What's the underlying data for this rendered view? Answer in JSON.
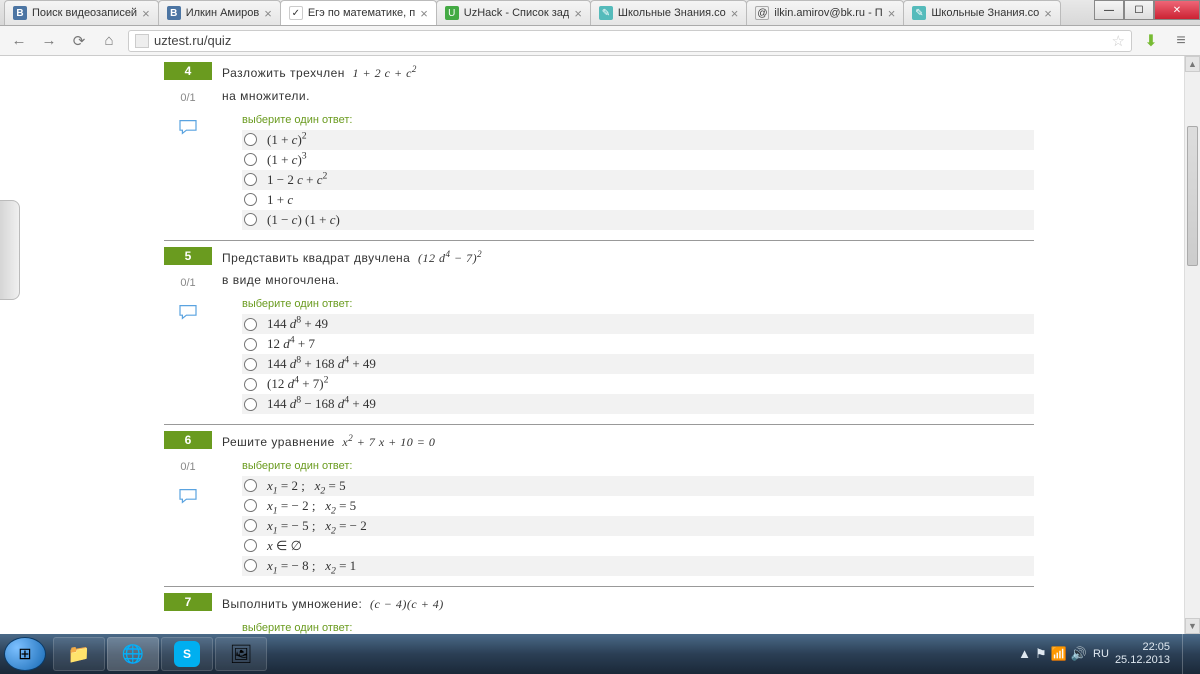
{
  "window": {
    "min": "—",
    "max": "☐",
    "close": "✕"
  },
  "tabs": [
    {
      "fav": "B",
      "favclass": "fav-vk",
      "title": "Поиск видеозаписей",
      "active": false
    },
    {
      "fav": "B",
      "favclass": "fav-vk",
      "title": "Илкин Амиров",
      "active": false
    },
    {
      "fav": "✓",
      "favclass": "fav-uztest",
      "title": "Егэ по математике, п",
      "active": true
    },
    {
      "fav": "U",
      "favclass": "fav-uzhack",
      "title": "UzHack - Список зад",
      "active": false
    },
    {
      "fav": "✎",
      "favclass": "fav-znanija",
      "title": "Школьные Знания.co",
      "active": false
    },
    {
      "fav": "@",
      "favclass": "fav-mail",
      "title": "ilkin.amirov@bk.ru - П",
      "active": false
    },
    {
      "fav": "✎",
      "favclass": "fav-znanija",
      "title": "Школьные Знания.co",
      "active": false
    }
  ],
  "url": "uztest.ru/quiz",
  "nav": {
    "back": "←",
    "fwd": "→",
    "reload": "⟳",
    "home": "⌂",
    "star": "☆",
    "download": "⬇",
    "menu": "≡"
  },
  "questions": [
    {
      "num": "4",
      "score": "0/1",
      "prompt": "Разложить трехчлен &nbsp;<span class=\"math\">1 + 2 c + c<sup>2</sup></span><br>на множители.",
      "hint": "выберите один ответ:",
      "answers": [
        {
          "html": "(1 + <span class=\"math\">c</span>)<sup>2</sup>",
          "shaded": true
        },
        {
          "html": "(1 + <span class=\"math\">c</span>)<sup>3</sup>",
          "shaded": false
        },
        {
          "html": "1 − 2 <span class=\"math\">c</span> + <span class=\"math\">c</span><sup>2</sup>",
          "shaded": true
        },
        {
          "html": "1 + <span class=\"math\">c</span>",
          "shaded": false
        },
        {
          "html": "(1 − <span class=\"math\">c</span>) (1 + <span class=\"math\">c</span>)",
          "shaded": true
        }
      ]
    },
    {
      "num": "5",
      "score": "0/1",
      "prompt": "Представить квадрат двучлена&nbsp; <span class=\"math\">(12 d<sup>4</sup> − 7)<sup>2</sup></span><br>в виде многочлена.",
      "hint": "выберите один ответ:",
      "answers": [
        {
          "html": "144 <span class=\"math\">d</span><sup>8</sup> + 49",
          "shaded": true
        },
        {
          "html": "12 <span class=\"math\">d</span><sup>4</sup> + 7",
          "shaded": false
        },
        {
          "html": "144 <span class=\"math\">d</span><sup>8</sup> + 168 <span class=\"math\">d</span><sup>4</sup> + 49",
          "shaded": true
        },
        {
          "html": "(12 <span class=\"math\">d</span><sup>4</sup> + 7)<sup>2</sup>",
          "shaded": false
        },
        {
          "html": "144 <span class=\"math\">d</span><sup>8</sup> − 168 <span class=\"math\">d</span><sup>4</sup> + 49",
          "shaded": true
        }
      ]
    },
    {
      "num": "6",
      "score": "0/1",
      "prompt": "Решите уравнение&nbsp; <span class=\"math\">x<sup>2</sup> + 7 x + 10 = 0</span>",
      "hint": "выберите один ответ:",
      "answers": [
        {
          "html": "<span class=\"math\">x<sub>1</sub></span> = 2 ;&nbsp;&nbsp; <span class=\"math\">x<sub>2</sub></span> = 5",
          "shaded": true
        },
        {
          "html": "<span class=\"math\">x<sub>1</sub></span> = − 2 ;&nbsp;&nbsp; <span class=\"math\">x<sub>2</sub></span> = 5",
          "shaded": false
        },
        {
          "html": "<span class=\"math\">x<sub>1</sub></span> = − 5 ;&nbsp;&nbsp; <span class=\"math\">x<sub>2</sub></span> = − 2",
          "shaded": true
        },
        {
          "html": "<span class=\"math\">x</span> ∈ ∅",
          "shaded": false
        },
        {
          "html": "<span class=\"math\">x<sub>1</sub></span> = − 8 ;&nbsp;&nbsp; <span class=\"math\">x<sub>2</sub></span> = 1",
          "shaded": true
        }
      ]
    },
    {
      "num": "7",
      "score": "",
      "prompt": "Выполнить умножение:&nbsp; <span class=\"math\">(c − 4)(c + 4)</span>",
      "hint": "выберите один ответ:",
      "answers": []
    }
  ],
  "tray": {
    "lang": "RU",
    "up": "▲",
    "time": "22:05",
    "date": "25.12.2013"
  },
  "taskbar_icons": [
    {
      "glyph": "📁",
      "active": false
    },
    {
      "glyph": "🌐",
      "active": true
    },
    {
      "glyph": "S",
      "active": false,
      "style": "background:#00aff0;color:#fff;font-weight:bold;border-radius:6px;width:26px;height:26px;display:flex;align-items:center;justify-content:center;"
    },
    {
      "glyph": "🖼",
      "active": false
    }
  ]
}
